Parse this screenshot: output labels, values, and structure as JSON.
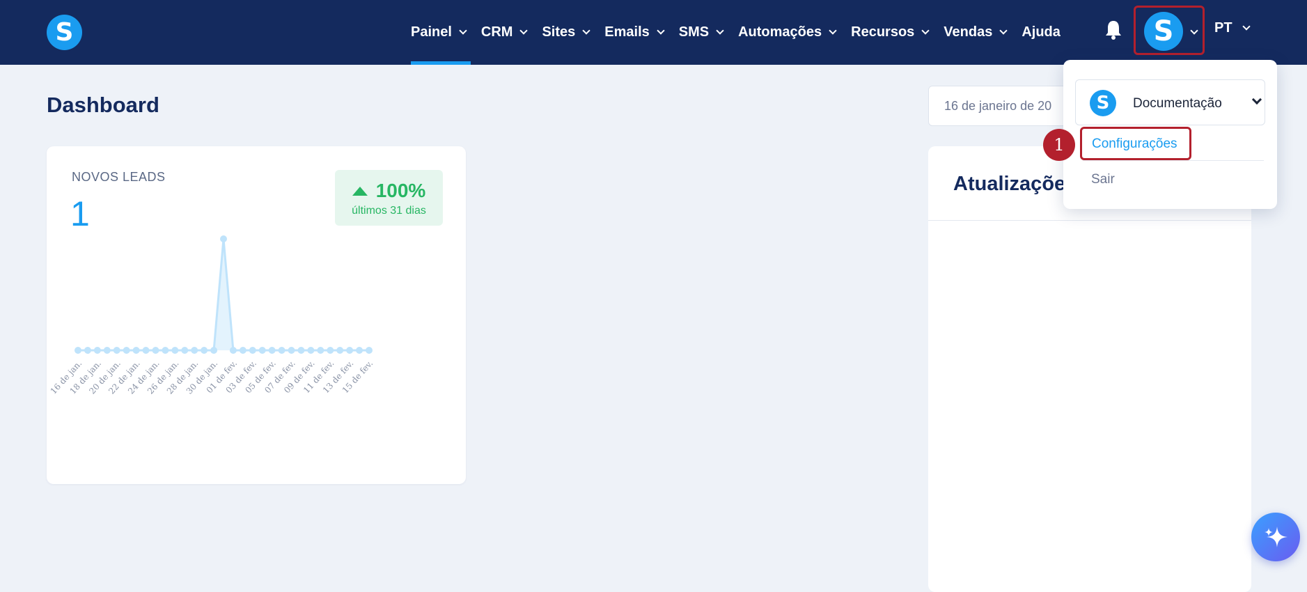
{
  "brand": {
    "logo_letter": "S"
  },
  "nav": {
    "items": [
      {
        "label": "Painel",
        "has_menu": true,
        "active": true
      },
      {
        "label": "CRM",
        "has_menu": true
      },
      {
        "label": "Sites",
        "has_menu": true
      },
      {
        "label": "Emails",
        "has_menu": true
      },
      {
        "label": "SMS",
        "has_menu": true
      },
      {
        "label": "Automações",
        "has_menu": true
      },
      {
        "label": "Recursos",
        "has_menu": true
      },
      {
        "label": "Vendas",
        "has_menu": true
      },
      {
        "label": "Ajuda",
        "has_menu": false
      }
    ],
    "avatar_letter": "S",
    "language": "PT"
  },
  "page": {
    "title": "Dashboard",
    "date_range": "16 de janeiro de 20"
  },
  "leads_card": {
    "label": "NOVOS LEADS",
    "value": "1",
    "change": "100%",
    "period": "últimos 31 dias"
  },
  "chart_data": {
    "type": "area",
    "x": [
      "16 de jan.",
      "17 de jan.",
      "18 de jan.",
      "19 de jan.",
      "20 de jan.",
      "21 de jan.",
      "22 de jan.",
      "23 de jan.",
      "24 de jan.",
      "25 de jan.",
      "26 de jan.",
      "27 de jan.",
      "28 de jan.",
      "29 de jan.",
      "30 de jan.",
      "31 de jan.",
      "01 de fev.",
      "02 de fev.",
      "03 de fev.",
      "04 de fev.",
      "05 de fev.",
      "06 de fev.",
      "07 de fev.",
      "08 de fev.",
      "09 de fev.",
      "10 de fev.",
      "11 de fev.",
      "12 de fev.",
      "13 de fev.",
      "14 de fev.",
      "15 de fev."
    ],
    "tick_labels": [
      "16 de jan.",
      "18 de jan.",
      "20 de jan.",
      "22 de jan.",
      "24 de jan.",
      "26 de jan.",
      "28 de jan.",
      "30 de jan.",
      "01 de fev.",
      "03 de fev.",
      "05 de fev.",
      "07 de fev.",
      "09 de fev.",
      "11 de fev.",
      "13 de fev.",
      "15 de fev."
    ],
    "values": [
      0,
      0,
      0,
      0,
      0,
      0,
      0,
      0,
      0,
      0,
      0,
      0,
      0,
      0,
      0,
      1,
      0,
      0,
      0,
      0,
      0,
      0,
      0,
      0,
      0,
      0,
      0,
      0,
      0,
      0,
      0
    ],
    "ylim": [
      0,
      1
    ],
    "grid": false,
    "color": "#bfe3fb"
  },
  "updates": {
    "title": "Atualizaçõe"
  },
  "dropdown": {
    "account_letter": "S",
    "account_name": "Documentação",
    "settings_label": "Configurações",
    "logout_label": "Sair"
  },
  "annotation": {
    "step": "1"
  },
  "colors": {
    "navbar": "#142a5e",
    "accent": "#1a9cf0",
    "highlight": "#b3202d",
    "positive": "#27b663"
  }
}
